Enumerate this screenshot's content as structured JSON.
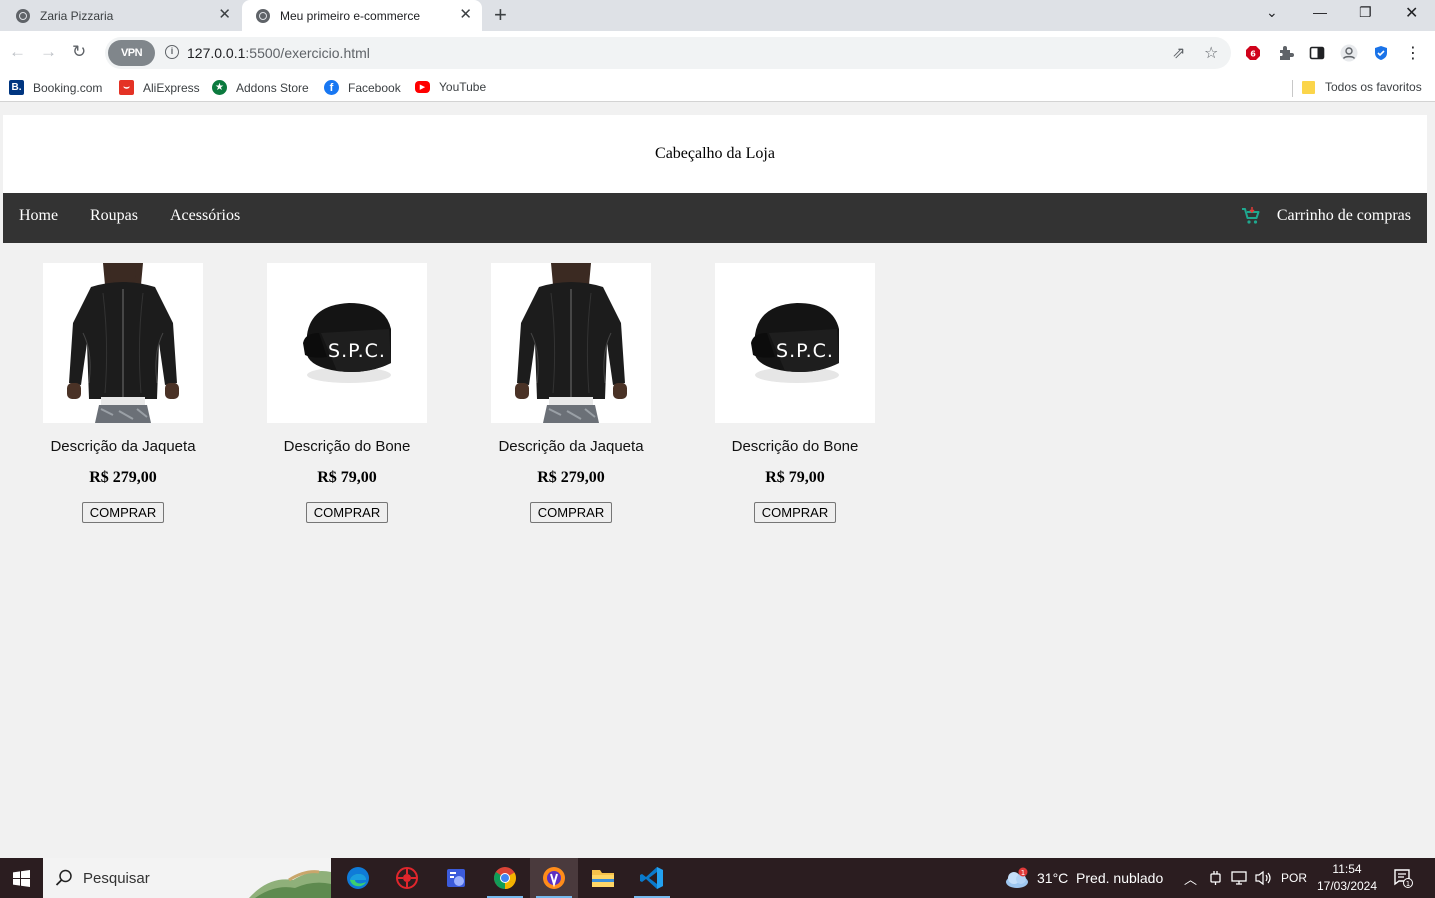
{
  "browser": {
    "tabs": [
      {
        "title": "Zaria Pizzaria"
      },
      {
        "title": "Meu primeiro e-commerce"
      }
    ],
    "vpn_label": "VPN",
    "url_host": "127.0.0.1",
    "url_path": ":5500/exercicio.html",
    "bookmarks": [
      {
        "label": "Booking.com",
        "icon": "booking-icon",
        "color": "#003580"
      },
      {
        "label": "AliExpress",
        "icon": "aliexpress-icon",
        "color": "#e43225"
      },
      {
        "label": "Addons Store",
        "icon": "addons-store-icon",
        "color": "#0b7a3e"
      },
      {
        "label": "Facebook",
        "icon": "facebook-icon",
        "color": "#1877f2"
      },
      {
        "label": "YouTube",
        "icon": "youtube-icon",
        "color": "#ff0000"
      }
    ],
    "all_bookmarks_label": "Todos os favoritos"
  },
  "store": {
    "header_title": "Cabeçalho da Loja",
    "nav": [
      {
        "label": "Home"
      },
      {
        "label": "Roupas"
      },
      {
        "label": "Acessórios"
      }
    ],
    "cart_label": "Carrinho de compras",
    "cart_icon_color": "#1fa88f",
    "products": [
      {
        "description": "Descrição da Jaqueta",
        "price": "R$ 279,00",
        "button": "COMPRAR",
        "image": "jacket"
      },
      {
        "description": "Descrição do Bone",
        "price": "R$ 79,00",
        "button": "COMPRAR",
        "image": "cap"
      },
      {
        "description": "Descrição da Jaqueta",
        "price": "R$ 279,00",
        "button": "COMPRAR",
        "image": "jacket"
      },
      {
        "description": "Descrição do Bone",
        "price": "R$ 79,00",
        "button": "COMPRAR",
        "image": "cap"
      }
    ],
    "cap_text": "S.P.C."
  },
  "taskbar": {
    "search_placeholder": "Pesquisar",
    "weather": "31°C  Pred. nublado",
    "weather_badge": "1",
    "language": "POR",
    "time": "11:54",
    "date": "17/03/2024",
    "notifications": "1"
  }
}
